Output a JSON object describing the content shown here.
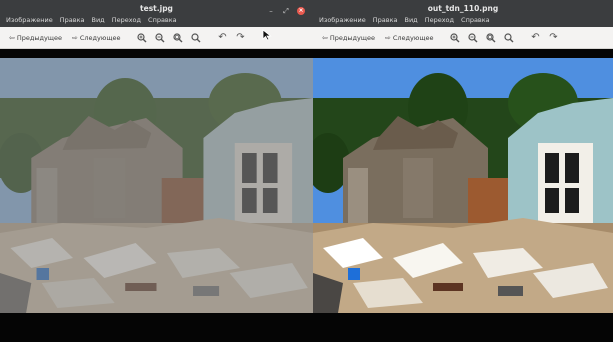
{
  "left_window": {
    "title": "test.jpg",
    "menu": [
      "Изображение",
      "Правка",
      "Вид",
      "Переход",
      "Справка"
    ],
    "toolbar": {
      "prev_label": "Предыдущее",
      "next_label": "Следующее"
    }
  },
  "right_window": {
    "title": "out_tdn_110.png",
    "menu": [
      "Изображение",
      "Правка",
      "Вид",
      "Переход",
      "Справка"
    ],
    "toolbar": {
      "prev_label": "Предыдущее",
      "next_label": "Следующее"
    }
  },
  "colors": {
    "titlebar": "#3b3d3f",
    "close_button": "#e95a4f",
    "toolbar": "#f4f3f2",
    "viewport": "#050505"
  },
  "icons": [
    "minimize-icon",
    "maximize-icon",
    "close-icon",
    "back-arrow-icon",
    "forward-arrow-icon",
    "zoom-in-icon",
    "zoom-out-icon",
    "zoom-fit-icon",
    "zoom-normal-icon",
    "rotate-left-icon",
    "rotate-right-icon",
    "mouse-cursor-icon"
  ]
}
